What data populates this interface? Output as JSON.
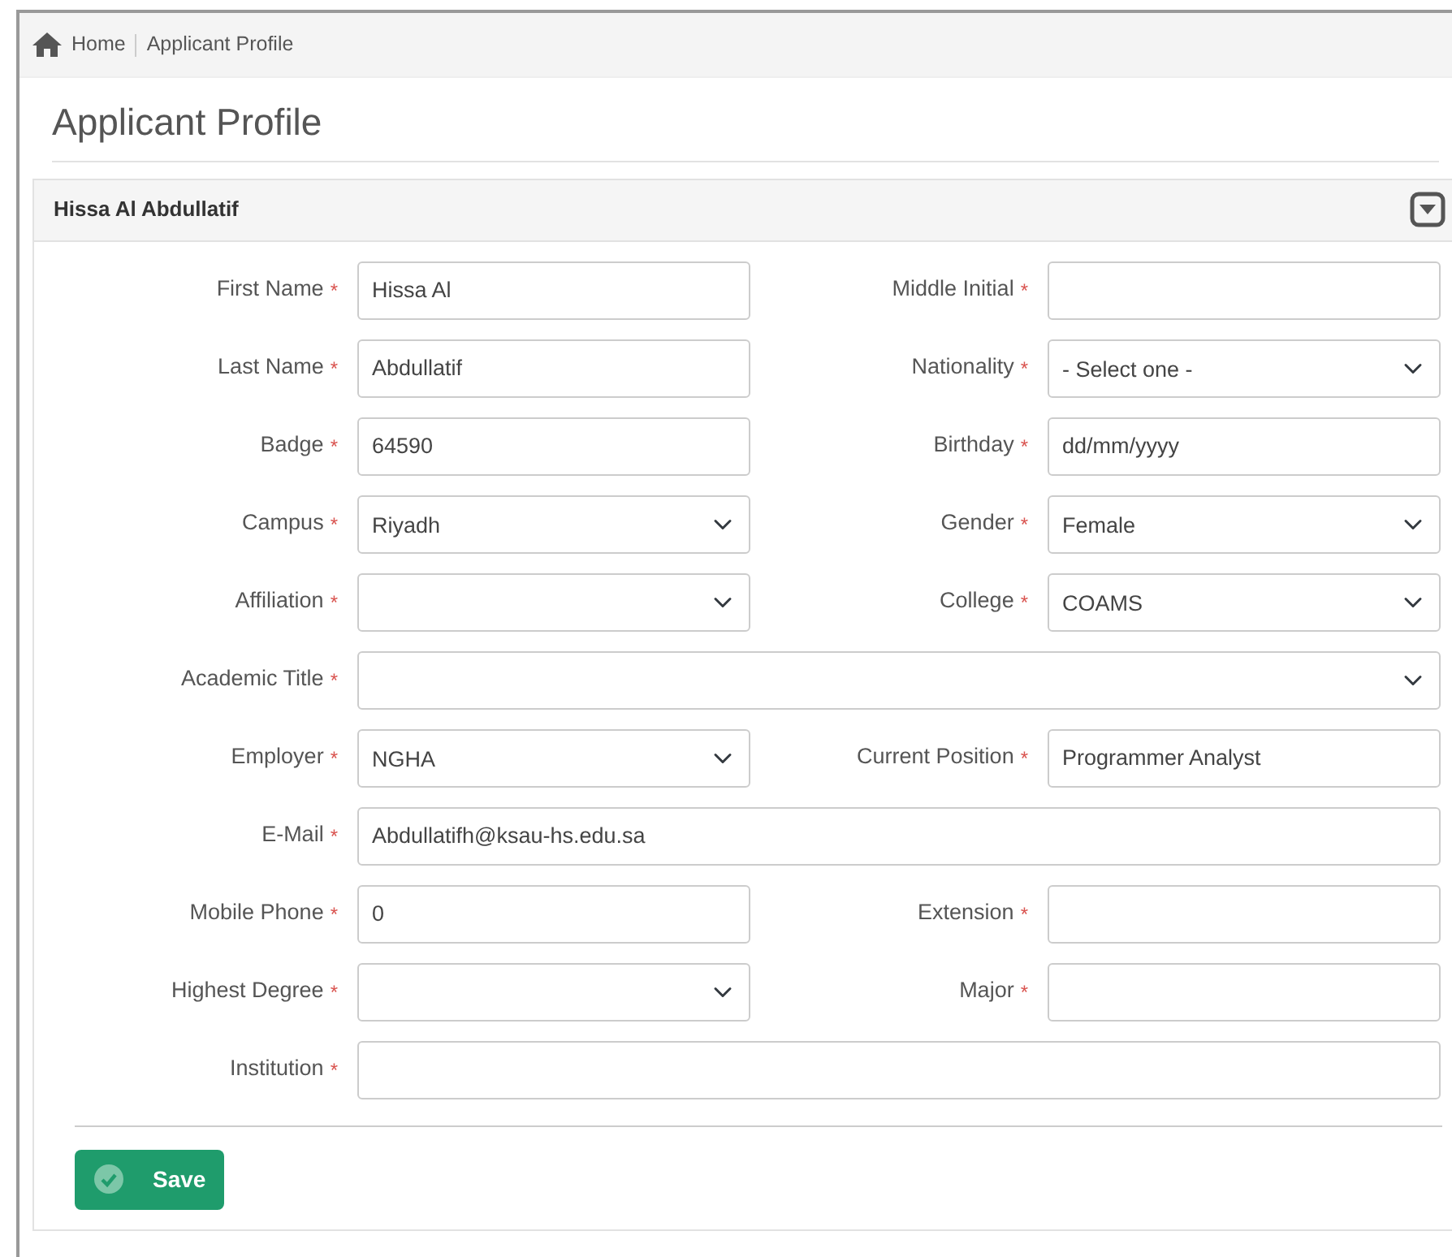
{
  "breadcrumb": [
    {
      "label": "Home"
    },
    {
      "label": "Applicant Profile"
    }
  ],
  "page_title": "Applicant Profile",
  "panel": {
    "title": "Hissa Al Abdullatif",
    "collapsed": false
  },
  "form": {
    "rows": [
      {
        "fields": [
          {
            "label": "First Name",
            "mark": "*",
            "kind": "text",
            "value": "Hissa Al"
          },
          {
            "label": "Middle Initial",
            "mark": "*",
            "kind": "text"
          }
        ]
      },
      {
        "fields": [
          {
            "label": "Last Name",
            "mark": "*",
            "kind": "text",
            "value": "Abdullatif"
          },
          {
            "label": "Nationality",
            "mark": "*",
            "kind": "select",
            "value": "- Select one -"
          }
        ]
      },
      {
        "fields": [
          {
            "label": "Badge",
            "mark": "*",
            "kind": "text",
            "value": "64590"
          },
          {
            "label": "Birthday",
            "mark": "*",
            "kind": "date",
            "value": "dd/mm/yyyy"
          }
        ]
      },
      {
        "fields": [
          {
            "label": "Campus",
            "mark": "*",
            "kind": "select",
            "value": "Riyadh"
          },
          {
            "label": "Gender",
            "mark": "*",
            "kind": "select",
            "value": "Female"
          }
        ]
      },
      {
        "fields": [
          {
            "label": "Affiliation",
            "mark": "*",
            "kind": "select"
          },
          {
            "label": "College",
            "mark": "*",
            "kind": "select",
            "value": "COAMS"
          }
        ]
      },
      {
        "fields": [
          {
            "label": "Academic Title",
            "mark": "*",
            "kind": "select"
          }
        ]
      },
      {
        "fields": [
          {
            "label": "Employer",
            "mark": "*",
            "kind": "select",
            "value": "NGHA"
          },
          {
            "label": "Current Position",
            "mark": "*",
            "kind": "text",
            "value": "Programmer Analyst"
          }
        ]
      },
      {
        "fields": [
          {
            "label": "E-Mail",
            "mark": "*",
            "kind": "text",
            "value": "Abdullatifh@ksau-hs.edu.sa"
          }
        ]
      },
      {
        "fields": [
          {
            "label": "Mobile Phone",
            "mark": "*",
            "kind": "text",
            "value": "0"
          },
          {
            "label": "Extension",
            "mark": "*",
            "kind": "text"
          }
        ]
      },
      {
        "fields": [
          {
            "label": "Highest Degree",
            "mark": "*",
            "kind": "select"
          },
          {
            "label": "Major",
            "mark": "*",
            "kind": "text"
          }
        ]
      },
      {
        "fields": [
          {
            "label": "Institution",
            "mark": "*",
            "kind": "text"
          }
        ]
      }
    ]
  },
  "save_button": {
    "label": "Save"
  }
}
